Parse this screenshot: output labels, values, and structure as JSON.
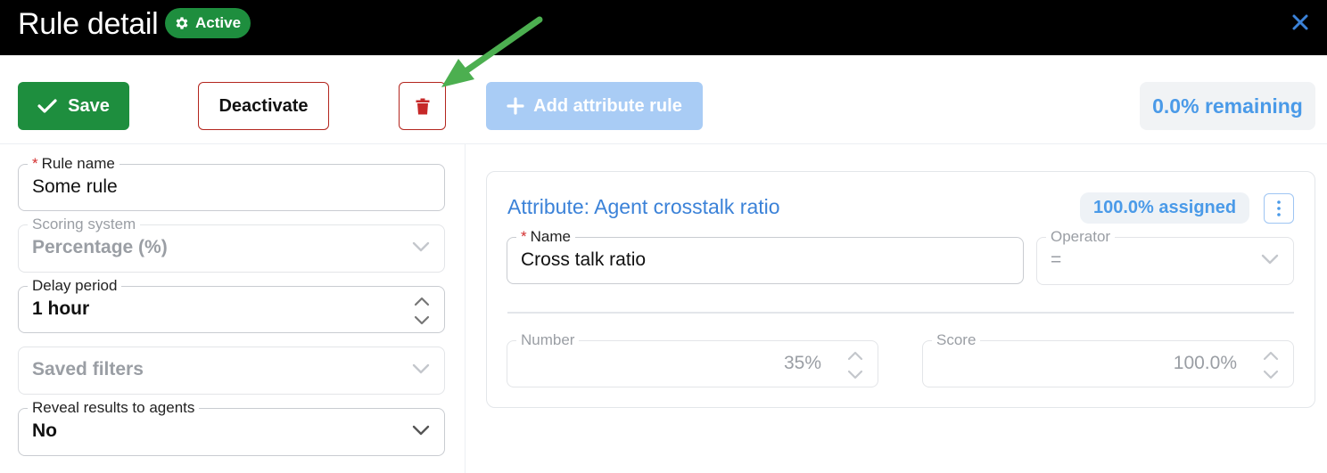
{
  "header": {
    "title": "Rule detail",
    "status_badge": "Active",
    "close_icon": "close-icon"
  },
  "toolbar": {
    "save_label": "Save",
    "deactivate_label": "Deactivate",
    "delete_icon": "trash-icon",
    "add_attribute_label": "Add attribute rule",
    "remaining_label": "0.0% remaining"
  },
  "form": {
    "rule_name": {
      "label": "Rule name",
      "required": true,
      "value": "Some rule"
    },
    "scoring_system": {
      "label": "Scoring system",
      "value": "Percentage (%)",
      "disabled": true
    },
    "delay_period": {
      "label": "Delay period",
      "value": "1 hour"
    },
    "saved_filters": {
      "label": "Saved filters",
      "placeholder": "Saved filters",
      "disabled": true
    },
    "reveal_results": {
      "label": "Reveal results to agents",
      "value": "No"
    }
  },
  "attribute_card": {
    "title": "Attribute: Agent crosstalk ratio",
    "assigned_label": "100.0% assigned",
    "name": {
      "label": "Name",
      "required": true,
      "value": "Cross talk ratio"
    },
    "operator": {
      "label": "Operator",
      "value": "=",
      "disabled": true
    },
    "number": {
      "label": "Number",
      "value": "35%",
      "disabled": true
    },
    "score": {
      "label": "Score",
      "value": "100.0%",
      "disabled": true
    }
  },
  "colors": {
    "brand_green": "#1e8e3e",
    "danger_red": "#b3261e",
    "link_blue": "#3b82d8",
    "annotation_arrow": "#4caf50"
  }
}
